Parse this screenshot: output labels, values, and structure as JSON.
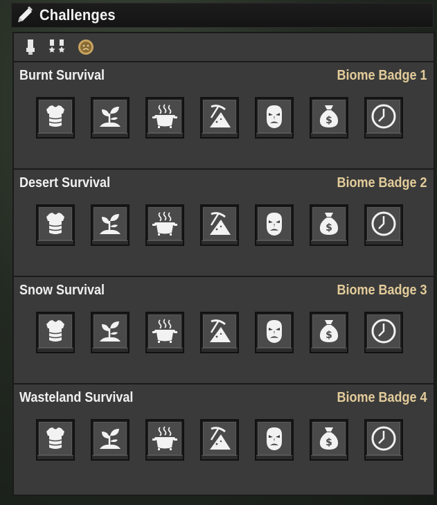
{
  "window": {
    "title": "Challenges",
    "title_icon": "pencil-icon"
  },
  "filters": [
    {
      "name": "single-medal-filter",
      "icon": "medal-icon"
    },
    {
      "name": "double-medal-filter",
      "icon": "double-medal-icon"
    },
    {
      "name": "biome-badge-filter",
      "icon": "sad-badge-icon"
    }
  ],
  "colors": {
    "badge_text": "#e3cc9a",
    "panel_bg": "#3a3a3a",
    "title_text": "#f2f2f2"
  },
  "sections": [
    {
      "title": "Burnt Survival",
      "badge": "Biome Badge 1",
      "challenges": [
        "armor-icon",
        "plant-icon",
        "cooking-pot-icon",
        "mining-icon",
        "zombie-head-icon",
        "money-bag-icon",
        "clock-icon"
      ]
    },
    {
      "title": "Desert Survival",
      "badge": "Biome Badge 2",
      "challenges": [
        "armor-icon",
        "plant-icon",
        "cooking-pot-icon",
        "mining-icon",
        "zombie-head-icon",
        "money-bag-icon",
        "clock-icon"
      ]
    },
    {
      "title": "Snow Survival",
      "badge": "Biome Badge 3",
      "challenges": [
        "armor-icon",
        "plant-icon",
        "cooking-pot-icon",
        "mining-icon",
        "zombie-head-icon",
        "money-bag-icon",
        "clock-icon"
      ]
    },
    {
      "title": "Wasteland Survival",
      "badge": "Biome Badge 4",
      "challenges": [
        "armor-icon",
        "plant-icon",
        "cooking-pot-icon",
        "mining-icon",
        "zombie-head-icon",
        "money-bag-icon",
        "clock-icon"
      ]
    }
  ]
}
